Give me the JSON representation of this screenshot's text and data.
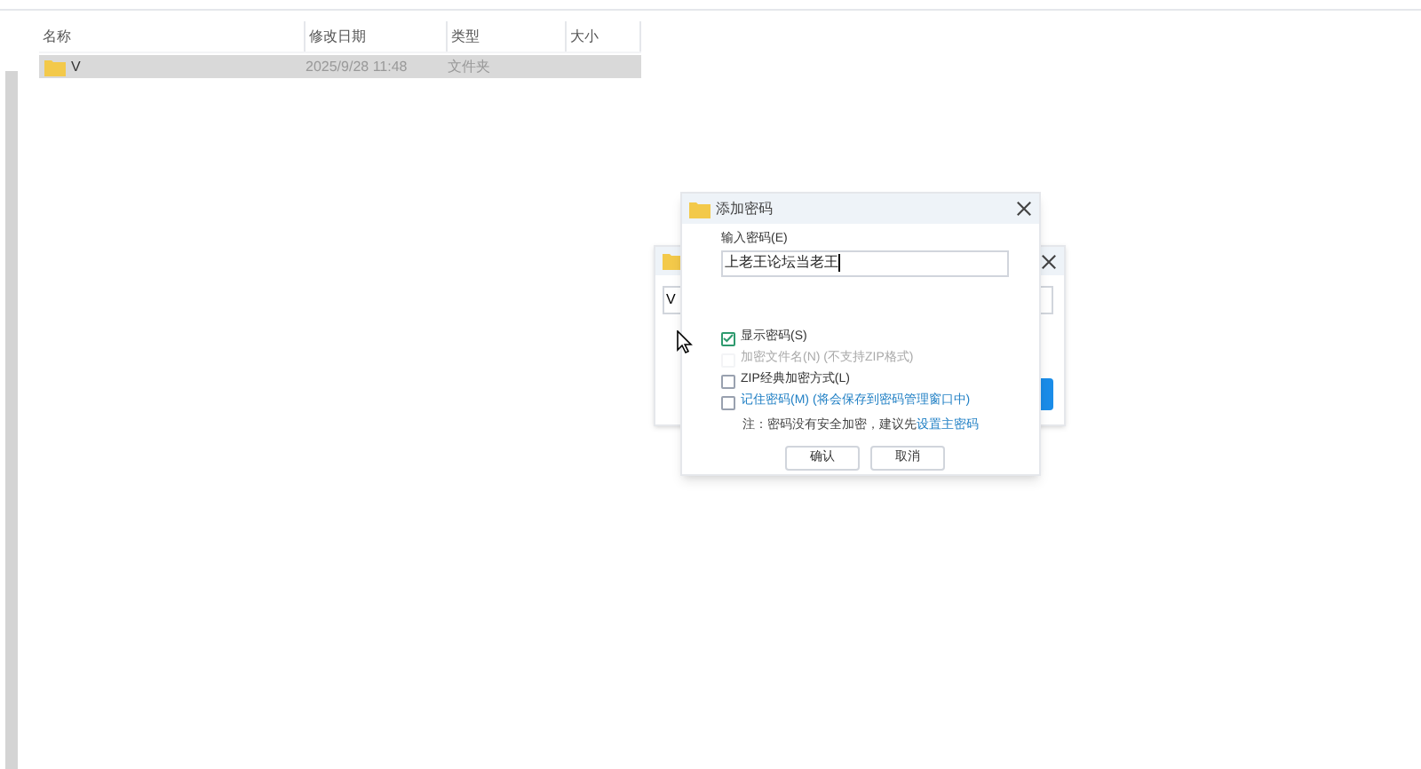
{
  "file_list": {
    "columns": [
      "名称",
      "修改日期",
      "类型",
      "大小"
    ],
    "rows": [
      {
        "name": "V",
        "modified": "2025/9/28 11:48",
        "type": "文件夹",
        "selected": true
      }
    ]
  },
  "back_dialog": {
    "field_value": "V"
  },
  "password_dialog": {
    "title": "添加密码",
    "field_label": "输入密码(E)",
    "field_value": "上老王论坛当老王",
    "options": [
      {
        "label": "显示密码(S)",
        "checked": true,
        "disabled": false,
        "kind": "plain"
      },
      {
        "label": "加密文件名(N) (不支持ZIP格式)",
        "checked": false,
        "disabled": true,
        "kind": "plain"
      },
      {
        "label": "ZIP经典加密方式(L)",
        "checked": false,
        "disabled": false,
        "kind": "plain"
      },
      {
        "label": "记住密码(M) (将会保存到密码管理窗口中)",
        "checked": false,
        "disabled": false,
        "kind": "link"
      }
    ],
    "note": "注：密码没有安全加密，建议先",
    "note_link": "设置主密码",
    "buttons": [
      "确认",
      "取消"
    ]
  }
}
